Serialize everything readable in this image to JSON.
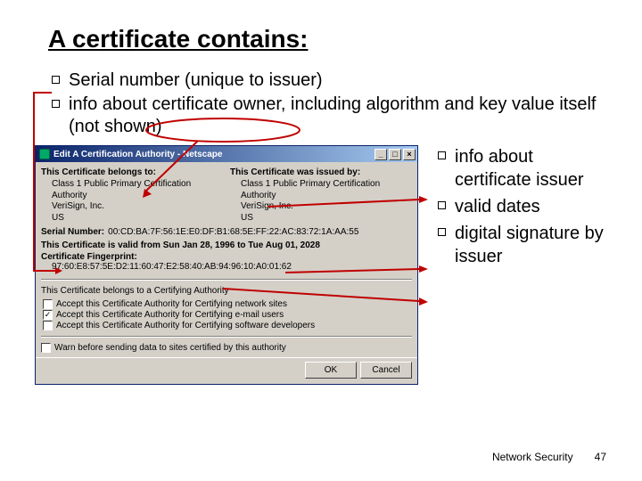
{
  "title": "A certificate contains:",
  "bullets_top": [
    "Serial number (unique to issuer)",
    "info about certificate owner, including algorithm and key value itself (not shown)"
  ],
  "bullets_side": [
    "info about certificate issuer",
    "valid dates",
    "digital signature by issuer"
  ],
  "dialog": {
    "window_title": "Edit A Certification Authority - Netscape",
    "belongs_head": "This Certificate belongs to:",
    "issued_head": "This Certificate was issued by:",
    "belongs_lines": [
      "Class 1 Public Primary Certification",
      "Authority",
      "VeriSign, Inc.",
      "US"
    ],
    "issued_lines": [
      "Class 1 Public Primary Certification",
      "Authority",
      "VeriSign, Inc.",
      "US"
    ],
    "serial_label": "Serial Number:",
    "serial_value": "00:CD:BA:7F:56:1E:E0:DF:B1:68:5E:FF:22:AC:83:72:1A:AA:55",
    "valid_line": "This Certificate is valid from Sun Jan 28, 1996 to Tue Aug 01, 2028",
    "fingerprint_label": "Certificate Fingerprint:",
    "fingerprint_value": "97:60:E8:57:5E:D2:11:60:47:E2:58:40:AB:94:96:10:A0:01:62",
    "authority_note": "This Certificate belongs to a Certifying Authority",
    "checks": [
      {
        "label": "Accept this Certificate Authority for Certifying network sites",
        "checked": false
      },
      {
        "label": "Accept this Certificate Authority for Certifying e-mail users",
        "checked": true
      },
      {
        "label": "Accept this Certificate Authority for Certifying software developers",
        "checked": false
      }
    ],
    "warn": {
      "label": "Warn before sending data to sites certified by this authority",
      "checked": false
    },
    "ok": "OK",
    "cancel": "Cancel"
  },
  "footer": {
    "label": "Network Security",
    "page": "47"
  }
}
